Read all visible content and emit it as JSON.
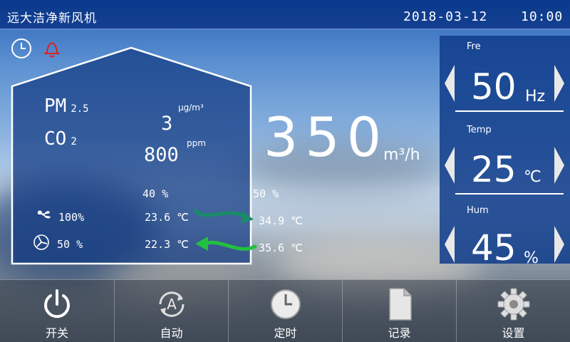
{
  "header": {
    "app_title": "远大洁净新风机",
    "date": "2018-03-12",
    "time": "10:00"
  },
  "status_icons": [
    "clock-icon",
    "bell-icon"
  ],
  "colors": {
    "top_bar": "#0a3a8c",
    "panel": "#103c8a",
    "bell": "#e02020",
    "arrow_in": "#1a8a6a",
    "arrow_out": "#22c040"
  },
  "house": {
    "pm_label": "PM",
    "pm_sub": "2.5",
    "co_label": "CO",
    "co_sub": "2",
    "pm_value": "3",
    "pm_unit": "μg/m³",
    "co2_value": "800",
    "co2_unit": "ppm",
    "indoor_humidity": "40 %",
    "fan_speed": "100%",
    "damper": "50 %",
    "temp_supply": "23.6 ℃",
    "temp_exhaust": "22.3 ℃"
  },
  "outdoor": {
    "humidity": "50 %",
    "temp_in": "34.9 ℃",
    "temp_out": "35.6 ℃"
  },
  "airflow": {
    "value": "350",
    "unit": "m³/h"
  },
  "right_panel": {
    "freq": {
      "title": "Fre",
      "value": "50",
      "unit": "Hz"
    },
    "temp": {
      "title": "Temp",
      "value": "25",
      "unit": "℃"
    },
    "hum": {
      "title": "Hum",
      "value": "45",
      "unit": "%"
    }
  },
  "bottom_bar": {
    "power": "开关",
    "auto": "自动",
    "timer": "定时",
    "record": "记录",
    "settings": "设置"
  }
}
